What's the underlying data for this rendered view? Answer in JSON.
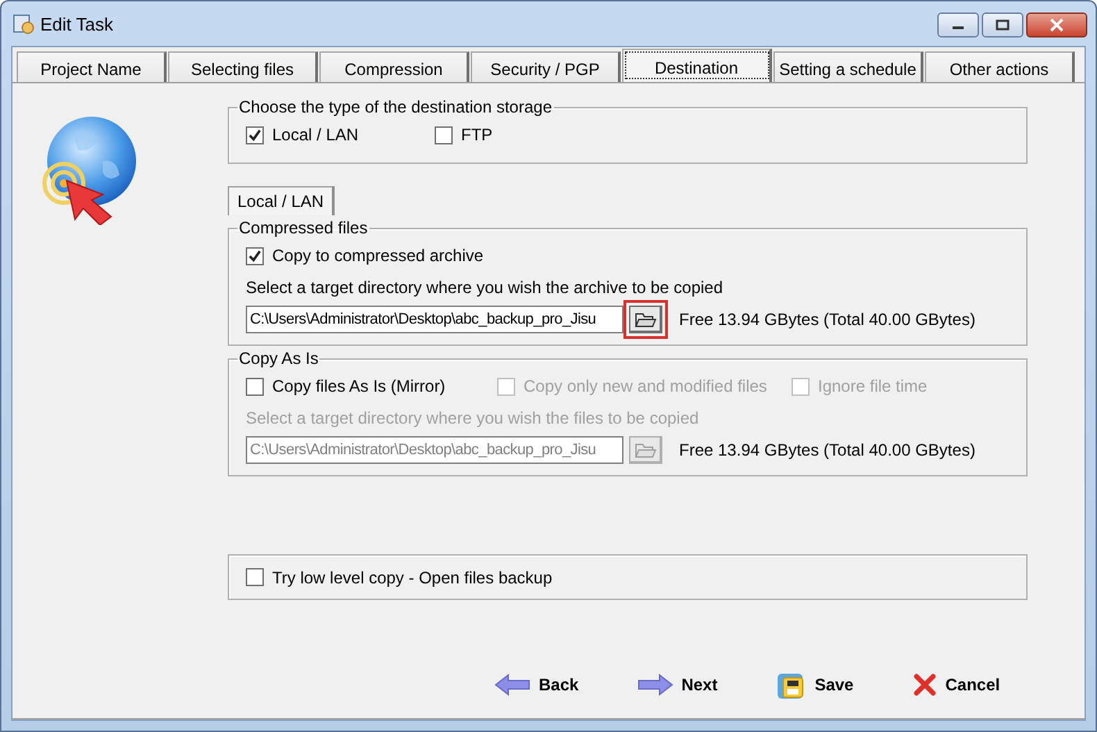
{
  "window": {
    "title": "Edit Task"
  },
  "tabs": [
    {
      "label": "Project Name",
      "selected": false
    },
    {
      "label": "Selecting files",
      "selected": false
    },
    {
      "label": "Compression",
      "selected": false
    },
    {
      "label": "Security / PGP",
      "selected": false
    },
    {
      "label": "Destination",
      "selected": true
    },
    {
      "label": "Setting a schedule",
      "selected": false
    },
    {
      "label": "Other actions",
      "selected": false
    }
  ],
  "storage": {
    "legend": "Choose the type of the destination storage",
    "options": [
      {
        "label": "Local / LAN",
        "checked": true
      },
      {
        "label": "FTP",
        "checked": false
      }
    ]
  },
  "subtab": {
    "label": "Local / LAN"
  },
  "sections": [
    {
      "legend": "Compressed files",
      "options": [
        {
          "label": "Copy to compressed archive",
          "checked": true,
          "disabled": false
        }
      ],
      "prompt": {
        "text": "Select a target directory where you wish the archive to be copied",
        "disabled": false
      },
      "path": {
        "value": "C:\\Users\\Administrator\\Desktop\\abc_backup_pro_Jisu",
        "disabled": false
      },
      "browse": {
        "highlighted": true,
        "disabled": false
      },
      "free": "Free 13.94 GBytes (Total 40.00 GBytes)"
    },
    {
      "legend": "Copy As Is",
      "options": [
        {
          "label": "Copy files As Is (Mirror)",
          "checked": false,
          "disabled": false
        },
        {
          "label": "Copy only new and modified files",
          "checked": false,
          "disabled": true
        },
        {
          "label": "Ignore file time",
          "checked": false,
          "disabled": true
        }
      ],
      "prompt": {
        "text": "Select a target directory where you wish the files to be copied",
        "disabled": true
      },
      "path": {
        "value": "C:\\Users\\Administrator\\Desktop\\abc_backup_pro_Jisu",
        "disabled": true
      },
      "browse": {
        "disabled": true
      },
      "free": "Free 13.94 GBytes (Total 40.00 GBytes)"
    }
  ],
  "low_level": {
    "label": "Try low level copy -  Open files backup",
    "checked": false
  },
  "buttons": [
    {
      "label": "Back",
      "kind": "back"
    },
    {
      "label": "Next",
      "kind": "next"
    },
    {
      "label": "Save",
      "kind": "save"
    },
    {
      "label": "Cancel",
      "kind": "cancel"
    }
  ]
}
